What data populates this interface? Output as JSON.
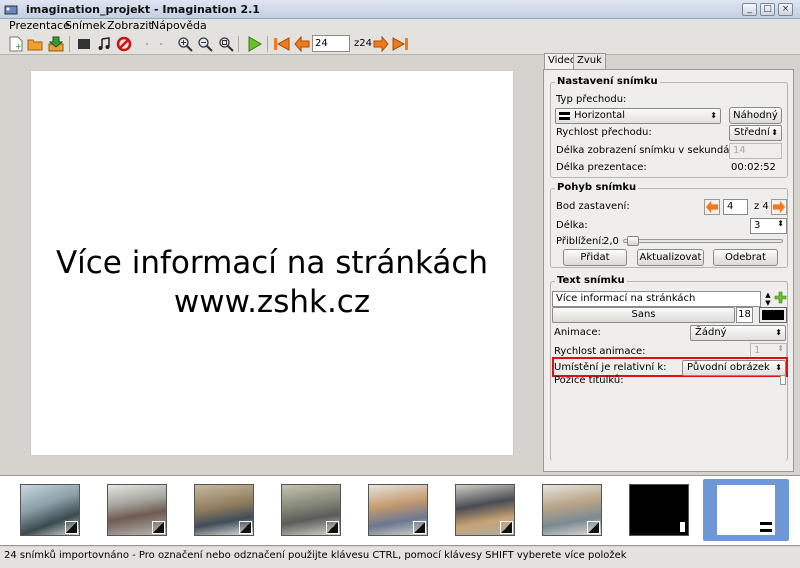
{
  "window": {
    "title": "imagination_projekt - Imagination 2.1"
  },
  "menu": [
    "Prezentace",
    "Snímek",
    "Zobrazit",
    "Nápověda"
  ],
  "toolbar": {
    "slide_number": "24",
    "slide_total": "z24",
    "icons": [
      "new-icon",
      "open-icon",
      "save-icon",
      "import-pictures-icon",
      "import-music-icon",
      "delete-icon",
      "zoom-in-icon",
      "zoom-out-icon",
      "zoom-fit-icon",
      "play-icon",
      "first-slide-icon",
      "prev-slide-icon",
      "next-slide-icon",
      "last-slide-icon"
    ]
  },
  "slide": {
    "line1": "Více informací na stránkách",
    "line2": "www.zshk.cz"
  },
  "tabs": [
    "Video",
    "Zvuk"
  ],
  "nastaveni": {
    "title": "Nastavení snímku",
    "typ_label": "Typ přechodu:",
    "typ_value": "Horizontal",
    "random_button": "Náhodný",
    "rychlost_label": "Rychlost přechodu:",
    "rychlost_value": "Střední",
    "delka_label": "Délka zobrazení snímku v sekundách:",
    "delka_value": "14",
    "prezentace_label": "Délka prezentace:",
    "prezentace_value": "00:02:52"
  },
  "pohyb": {
    "title": "Pohyb snímku",
    "bod_label": "Bod zastavení:",
    "bod_value": "4",
    "bod_total": "z 4",
    "delka_label": "Délka:",
    "delka_value": "3",
    "zoom_label": "Přiblížení:",
    "zoom_value": "2,0",
    "zoom_fraction": 0.02,
    "add_button": "Přidat",
    "update_button": "Aktualizovat",
    "remove_button": "Odebrat"
  },
  "text": {
    "title": "Text snímku",
    "text_value": "Více informací na stránkách",
    "font_name": "Sans",
    "font_size": "18",
    "font_color": "#000000",
    "animace_label": "Animace:",
    "animace_value": "Žádný",
    "rychlost_label": "Rychlost animace:",
    "rychlost_value": "1",
    "umisteni_label": "Umístění je relativní k:",
    "umisteni_value": "Původní obrázek",
    "pozice_label": "Pozice titulků:"
  },
  "status": "24 snímků importovnáno - Pro označení nebo odznačení použijte klávesu CTRL, pomocí klávesy SHIFT vyberete více položek",
  "colors": {
    "highlight_red": "#e01010",
    "selected_thumb": "#6e97d6"
  }
}
